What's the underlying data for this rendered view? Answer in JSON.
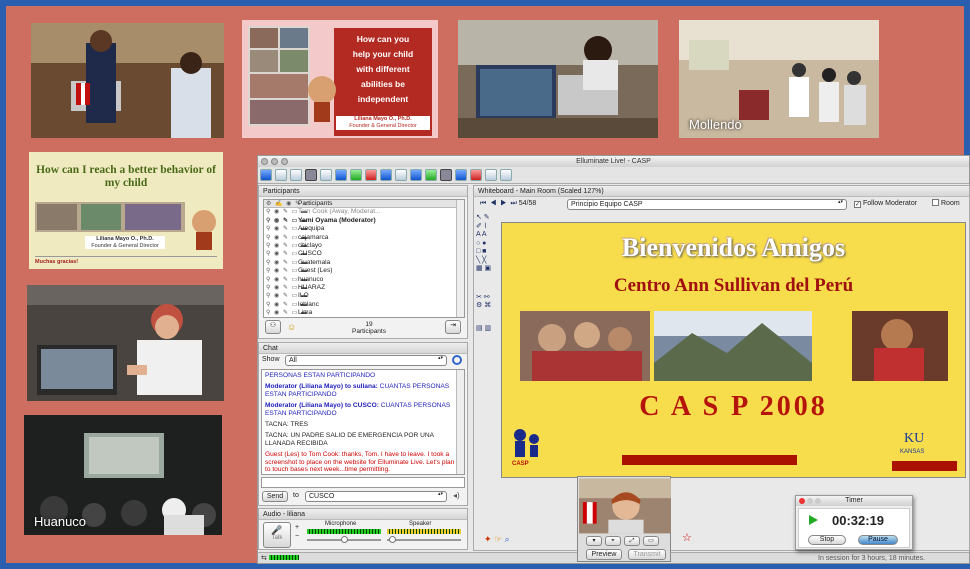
{
  "photos": {
    "mollendo_caption": "Mollendo",
    "huanuco_caption": "Huanuco",
    "poster_top": {
      "lines": [
        "How can you",
        "help your child",
        "with different",
        "abilities be",
        "independent"
      ],
      "author": "Liliana Mayo O., Ph.D.",
      "role": "Founder & General Director"
    },
    "poster_left": {
      "title": "How can I reach a better behavior of my child",
      "author": "Liliana Mayo O., Ph.D.",
      "role": "Founder & General Director",
      "thanks": "Muchas gracias!"
    }
  },
  "window": {
    "title": "Elluminate Live! - CASP"
  },
  "participants": {
    "header": "Participants",
    "column_label": "Participants",
    "rows": [
      {
        "name": "Tom Cook (Away, Moderat...",
        "style": "gray"
      },
      {
        "name": "Yemi Oyama (Moderator)",
        "style": "bold"
      },
      {
        "name": "Arequipa",
        "style": ""
      },
      {
        "name": "cajamarca",
        "style": ""
      },
      {
        "name": "chiclayo",
        "style": ""
      },
      {
        "name": "CUSCO",
        "style": ""
      },
      {
        "name": "Guatemala",
        "style": ""
      },
      {
        "name": "Guest (Les)",
        "style": ""
      },
      {
        "name": "huanuco",
        "style": ""
      },
      {
        "name": "HUARAZ",
        "style": ""
      },
      {
        "name": "ILO",
        "style": ""
      },
      {
        "name": "leblanc",
        "style": ""
      },
      {
        "name": "Lima",
        "style": ""
      },
      {
        "name": "linda",
        "style": ""
      },
      {
        "name": "sicuani",
        "style": ""
      },
      {
        "name": "sullana",
        "style": ""
      }
    ],
    "count": "19",
    "count_label": "Participants"
  },
  "chat": {
    "header": "Chat",
    "show_label": "Show",
    "show_value": "All",
    "messages": [
      {
        "type": "plain-blue",
        "text": "PERSONAS ESTAN PARTICIPANDO"
      },
      {
        "type": "mod",
        "sender": "Moderator (Liliana Mayo) to sullana:",
        "text": " CUANTAS PERSONAS ESTAN PARTICIPANDO"
      },
      {
        "type": "mod",
        "sender": "Moderator (Liliana Mayo) to CUSCO:",
        "text": " CUANTAS PERSONAS ESTAN PARTICIPANDO"
      },
      {
        "type": "plain",
        "sender": "",
        "text": "TACNA: TRES"
      },
      {
        "type": "plain",
        "sender": "",
        "text": "TACNA: UN PADRE SALIO DE EMERGENCIA POR UNA LLANADA RECIBIDA"
      },
      {
        "type": "guest",
        "sender": "",
        "text": "Guest (Les) to Tom Cook: thanks, Tom.  I have to leave. I took a screenshot to place on the website for Elluminate Live.  Let's plan to touch bases next week...time permitting."
      }
    ],
    "send_label": "Send",
    "to_label": "to",
    "to_value": "CUSCO"
  },
  "audio": {
    "header": "Audio - liliana",
    "microphone_label": "Microphone",
    "speaker_label": "Speaker",
    "talk_label": "Talk"
  },
  "whiteboard": {
    "header": "Whiteboard - Main Room (Scaled 127%)",
    "page": "54/58",
    "screen_name": "Principio Equipo CASP",
    "follow_label": "Follow Moderator",
    "room_label": "Room",
    "slide": {
      "title": "Bienvenidos Amigos",
      "subtitle": "Centro Ann Sullivan del Perú",
      "year": "C A S P  2008",
      "casp_logo": "CASP",
      "ku_logo": "KU",
      "kansas": "KANSAS"
    }
  },
  "video": {
    "preview_label": "Preview",
    "transmit_label": "Transmit"
  },
  "timer": {
    "title": "Timer",
    "time": "00:32:19",
    "stop_label": "Stop",
    "pause_label": "Pause"
  },
  "status": {
    "session_text": "In session for 3 hours, 18 minutes."
  },
  "colors": {
    "background": "#cd6e60",
    "frame": "#2a5fb0",
    "slide_bg": "#f7dc4b",
    "slide_red": "#b5140a"
  }
}
